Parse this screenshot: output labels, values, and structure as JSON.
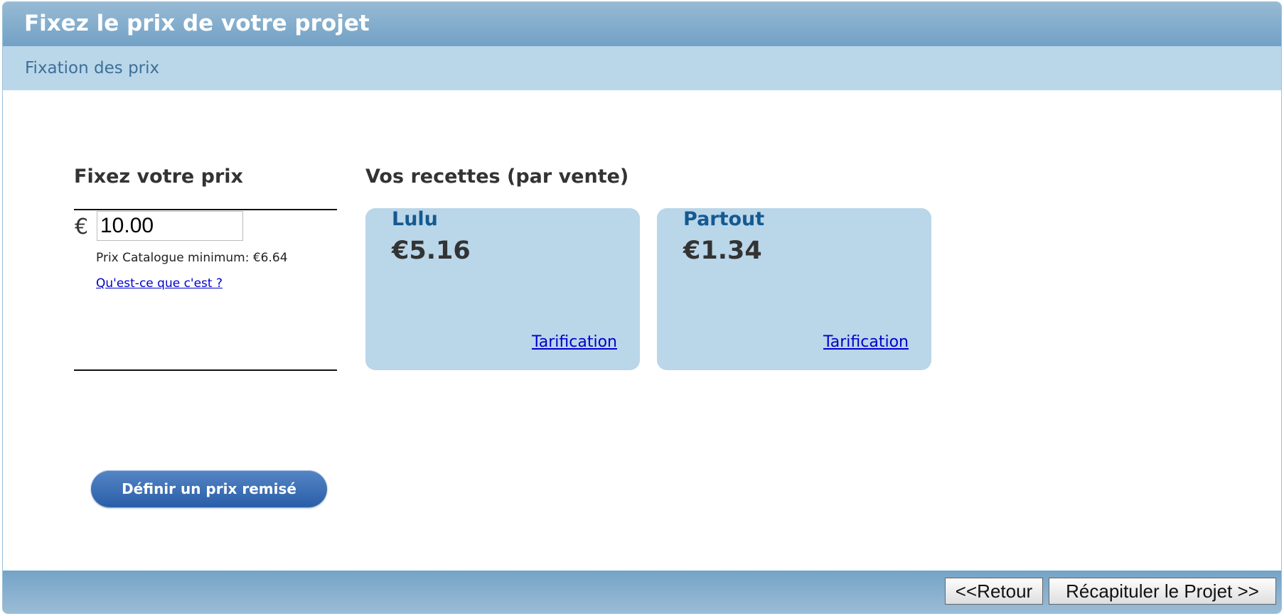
{
  "header": {
    "title": "Fixez le prix de votre projet"
  },
  "subheader": {
    "title": "Fixation des prix"
  },
  "pricing": {
    "heading": "Fixez votre prix",
    "currency_symbol": "€",
    "price_value": "10.00",
    "min_price_text": "Prix Catalogue minimum: €6.64",
    "help_link": "Qu'est-ce que c'est ?"
  },
  "revenue": {
    "heading": "Vos recettes (par vente)",
    "cards": [
      {
        "name": "Lulu",
        "amount": "€5.16",
        "link": "Tarification"
      },
      {
        "name": "Partout",
        "amount": "€1.34",
        "link": "Tarification"
      }
    ]
  },
  "discount_button": "Définir un prix remisé",
  "footer": {
    "back": "<<Retour",
    "next": "Récapituler le Projet >>"
  },
  "colors": {
    "header": "#7fa9ca",
    "subheader": "#bad6e9",
    "card": "#bad6e9",
    "button": "#3a6cb3"
  }
}
